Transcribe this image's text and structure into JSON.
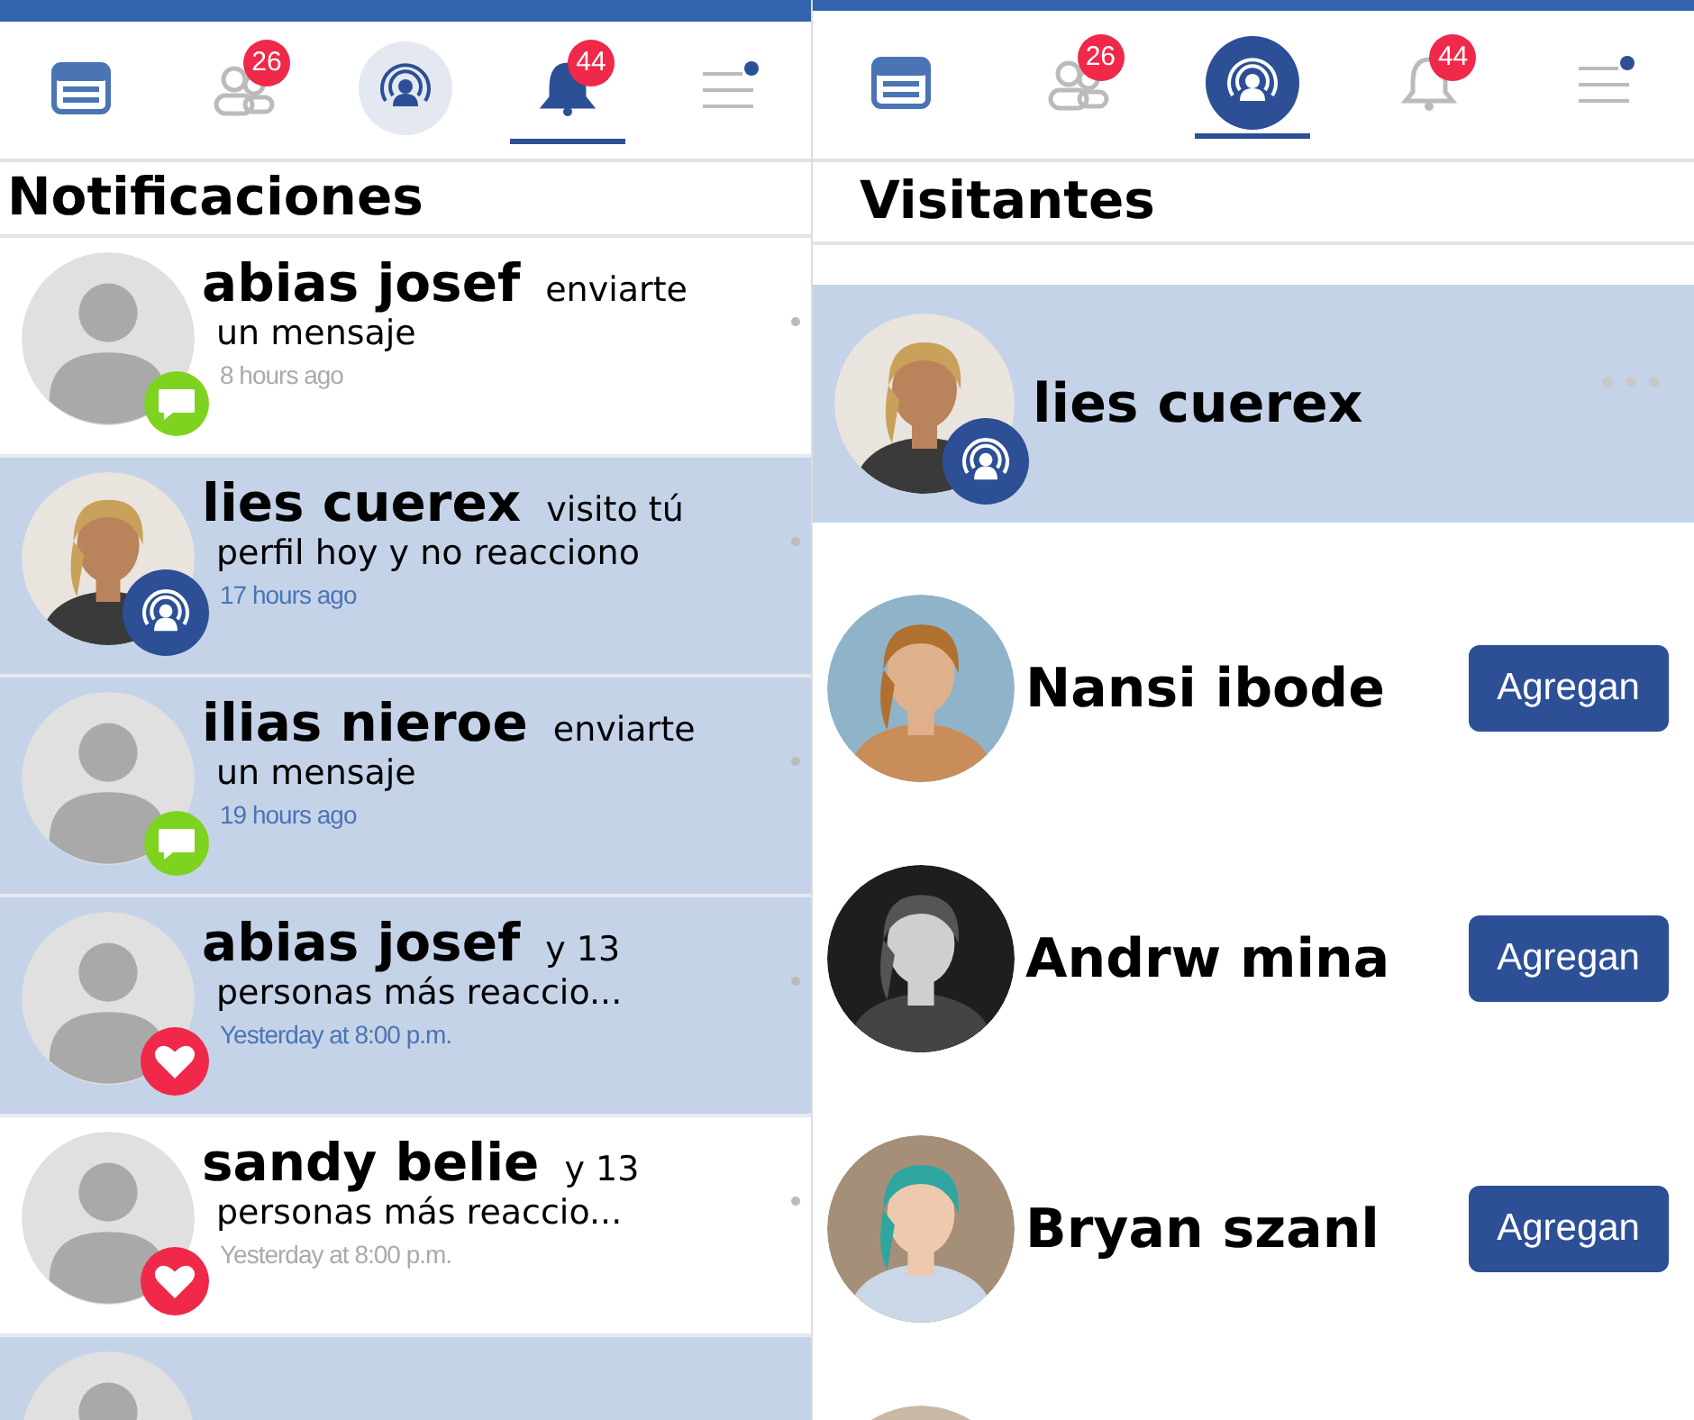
{
  "notifications_screen": {
    "tabs": [
      {
        "kind": "feed",
        "selected": false
      },
      {
        "kind": "friends",
        "badge": "26",
        "selected": false
      },
      {
        "kind": "broadcast",
        "selected": false
      },
      {
        "kind": "bell",
        "badge": "44",
        "selected": true
      },
      {
        "kind": "menu",
        "selected": false
      }
    ],
    "title": "Notificaciones",
    "items": [
      {
        "name": "abias josef",
        "action_line_1": "enviarte",
        "action_line_2": "un mensaje",
        "time": "8 hours ago",
        "avatar": {
          "kind": "placeholder"
        },
        "badge": {
          "kind": "message"
        },
        "unread": false
      },
      {
        "name": "lies cuerex",
        "action_line_1": "visito tú",
        "action_line_2": "perfil hoy y no reacciono",
        "time": "17 hours ago",
        "badge": {
          "kind": "visit"
        },
        "unread": true
      },
      {
        "name": "ilias nieroe",
        "action_line_1": "enviarte",
        "action_line_2": "un mensaje",
        "time": "19 hours ago",
        "avatar": {
          "kind": "placeholder"
        },
        "badge": {
          "kind": "message"
        },
        "unread": true
      },
      {
        "name": "abias josef",
        "action_line_1": "y 13",
        "action_line_2": "personas más reaccio...",
        "time": "Yesterday at 8:00 p.m.",
        "avatar": {
          "kind": "placeholder"
        },
        "badge": {
          "kind": "reaction"
        },
        "unread": true
      },
      {
        "name": "sandy belie",
        "action_line_1": "y 13",
        "action_line_2": "personas más reaccio...",
        "time": "Yesterday at 8:00 p.m.",
        "avatar": {
          "kind": "placeholder"
        },
        "badge": {
          "kind": "reaction"
        },
        "unread": false
      },
      {
        "avatar": {
          "kind": "placeholder"
        },
        "unread": true
      }
    ]
  },
  "visitors_screen": {
    "tabs": [
      {
        "kind": "feed",
        "selected": false
      },
      {
        "kind": "friends",
        "badge": "26",
        "selected": false
      },
      {
        "kind": "broadcast",
        "selected": true
      },
      {
        "kind": "bell",
        "badge": "44",
        "selected": false
      },
      {
        "kind": "menu",
        "selected": false
      }
    ],
    "title": "Visitantes",
    "items": [
      {
        "name": "lies cuerex",
        "badge": {
          "kind": "visit"
        },
        "selected": true
      },
      {
        "name": "Nansi ibode",
        "button": "Agregan",
        "selected": false
      },
      {
        "name": "Andrw mina",
        "button": "Agregan",
        "selected": false
      },
      {
        "name": "Bryan szanl",
        "button": "Agregan",
        "selected": false
      },
      {
        "selected": false
      }
    ]
  }
}
